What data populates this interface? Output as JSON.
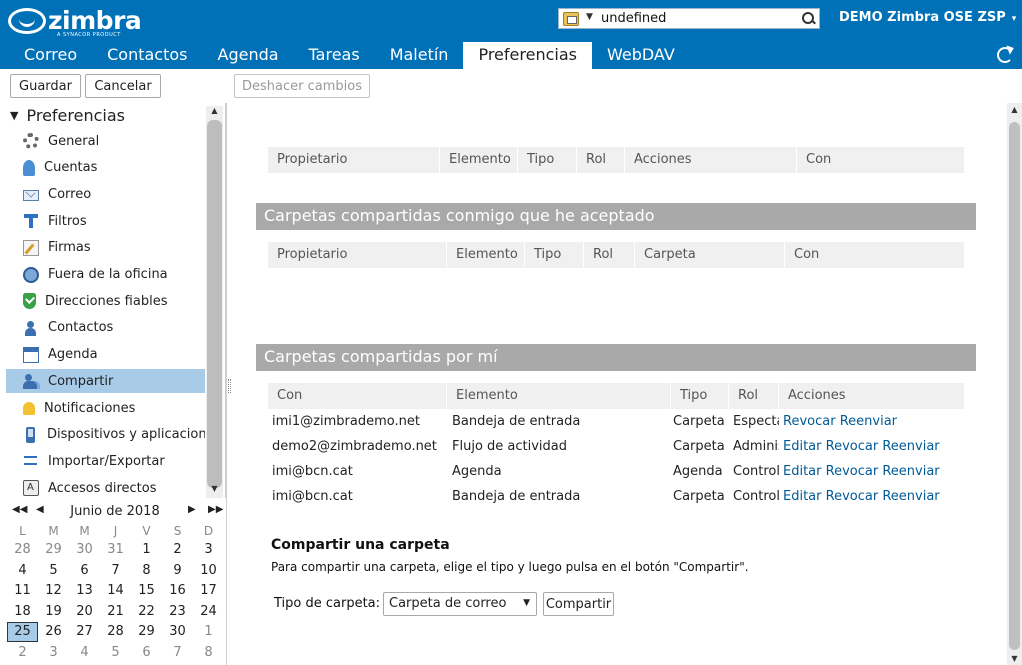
{
  "header": {
    "logo_text": "zimbra",
    "logo_tag": "A SYNACOR PRODUCT",
    "search_value": "undefined",
    "user_label": "DEMO Zimbra OSE ZSP",
    "user_caret": "▾"
  },
  "app_tabs": [
    "Correo",
    "Contactos",
    "Agenda",
    "Tareas",
    "Maletín",
    "Preferencias",
    "WebDAV"
  ],
  "toolbar": {
    "save": "Guardar",
    "cancel": "Cancelar",
    "undo": "Deshacer cambios"
  },
  "tree": {
    "title": "Preferencias",
    "items": [
      {
        "label": "General",
        "icon": "gear-icon"
      },
      {
        "label": "Cuentas",
        "icon": "accounts-icon"
      },
      {
        "label": "Correo",
        "icon": "mail-icon"
      },
      {
        "label": "Filtros",
        "icon": "filter-icon"
      },
      {
        "label": "Firmas",
        "icon": "signature-icon"
      },
      {
        "label": "Fuera de la oficina",
        "icon": "out-of-office-icon"
      },
      {
        "label": "Direcciones fiables",
        "icon": "trusted-shield-icon"
      },
      {
        "label": "Contactos",
        "icon": "contact-icon"
      },
      {
        "label": "Agenda",
        "icon": "calendar-icon"
      },
      {
        "label": "Compartir",
        "icon": "share-icon"
      },
      {
        "label": "Notificaciones",
        "icon": "bell-icon"
      },
      {
        "label": "Dispositivos y aplicaciones",
        "icon": "device-icon"
      },
      {
        "label": "Importar/Exportar",
        "icon": "import-export-icon"
      },
      {
        "label": "Accesos directos",
        "icon": "shortcut-icon"
      }
    ],
    "selected_index": 9
  },
  "minical": {
    "month_label": "Junio de 2018",
    "weekdays": [
      "L",
      "M",
      "M",
      "J",
      "V",
      "S",
      "D"
    ],
    "weeks": [
      [
        "28",
        "29",
        "30",
        "31",
        "1",
        "2",
        "3"
      ],
      [
        "4",
        "5",
        "6",
        "7",
        "8",
        "9",
        "10"
      ],
      [
        "11",
        "12",
        "13",
        "14",
        "15",
        "16",
        "17"
      ],
      [
        "18",
        "19",
        "20",
        "21",
        "22",
        "23",
        "24"
      ],
      [
        "25",
        "26",
        "27",
        "28",
        "29",
        "30",
        "1"
      ],
      [
        "2",
        "3",
        "4",
        "5",
        "6",
        "7",
        "8"
      ]
    ],
    "today": "25"
  },
  "pending_grid": {
    "columns": [
      "Propietario",
      "Elemento",
      "Tipo",
      "Rol",
      "Acciones",
      "Con"
    ]
  },
  "accepted_section": {
    "title": "Carpetas compartidas conmigo que he aceptado",
    "columns": [
      "Propietario",
      "Elemento",
      "Tipo",
      "Rol",
      "Carpeta",
      "Con"
    ]
  },
  "mine_section": {
    "title": "Carpetas compartidas por mí",
    "columns": [
      "Con",
      "Elemento",
      "Tipo",
      "Rol",
      "Acciones"
    ],
    "rows": [
      {
        "con": "imi1@zimbrademo.net",
        "elemento": "Bandeja de entrada",
        "tipo": "Carpeta de correo",
        "rol": "Espectador",
        "acciones": [
          "Revocar",
          "Reenviar"
        ]
      },
      {
        "con": "demo2@zimbrademo.net",
        "elemento": "Flujo de actividad",
        "tipo": "Carpeta de correo",
        "rol": "Administrador",
        "acciones": [
          "Editar",
          "Revocar",
          "Reenviar"
        ]
      },
      {
        "con": "imi@bcn.cat",
        "elemento": "Agenda",
        "tipo": "Agenda",
        "rol": "Controlador",
        "acciones": [
          "Editar",
          "Revocar",
          "Reenviar"
        ]
      },
      {
        "con": "imi@bcn.cat",
        "elemento": "Bandeja de entrada",
        "tipo": "Carpeta de correo",
        "rol": "Controlador",
        "acciones": [
          "Editar",
          "Revocar",
          "Reenviar"
        ]
      }
    ]
  },
  "share_folder": {
    "title": "Compartir una carpeta",
    "description": "Para compartir una carpeta, elige el tipo y luego pulsa en el botón \"Compartir\".",
    "type_label": "Tipo de carpeta:",
    "type_value": "Carpeta de correo",
    "share_button": "Compartir"
  }
}
